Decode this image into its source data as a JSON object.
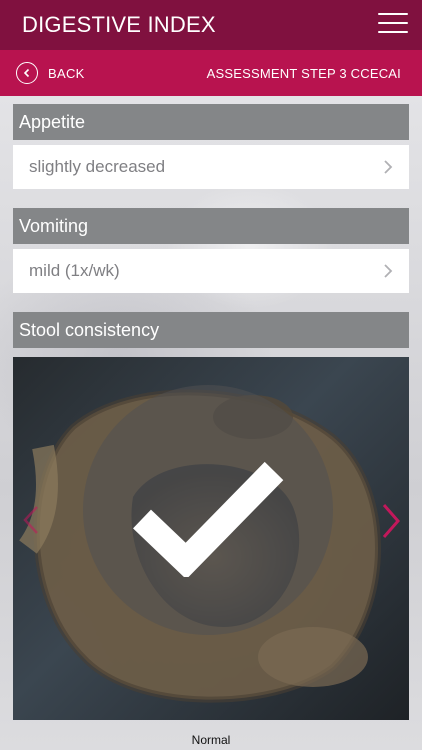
{
  "header": {
    "title": "DIGESTIVE INDEX",
    "menu_icon": "hamburger-menu-icon",
    "bg_color": "#80113f"
  },
  "subheader": {
    "back_label": "BACK",
    "back_icon": "chevron-left-circle-icon",
    "step_label": "ASSESSMENT STEP 3 CCECAI",
    "bg_color": "#b8134f"
  },
  "sections": [
    {
      "title": "Appetite",
      "value": "slightly decreased"
    },
    {
      "title": "Vomiting",
      "value": "mild (1x/wk)"
    },
    {
      "title": "Stool consistency"
    }
  ],
  "stool_carousel": {
    "selected_label": "Normal",
    "selected_icon": "checkmark-icon",
    "next_icon": "chevron-right-icon",
    "prev_icon": "chevron-left-icon",
    "accent_color": "#c2185b"
  }
}
